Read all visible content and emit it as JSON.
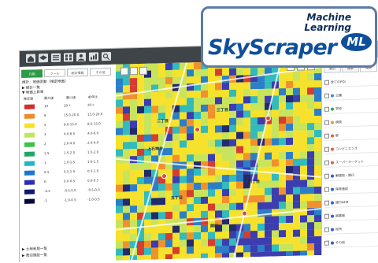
{
  "logo": {
    "line1": "Machine",
    "line2": "Learning",
    "brand": "SkyScraper",
    "badge": "ML"
  },
  "toolbar": {
    "icons": [
      "home-icon",
      "layer-icon",
      "list-icon",
      "grid-icon",
      "user-icon",
      "chart-icon",
      "search-icon"
    ]
  },
  "left_panel": {
    "tabs": [
      {
        "label": "凡例",
        "active": true
      },
      {
        "label": "ツール",
        "active": false
      },
      {
        "label": "統計情報",
        "active": false
      },
      {
        "label": "その他",
        "active": false
      }
    ],
    "header_text": "推計：地価変動（推定地価）",
    "section_open": "▶ 推計一覧",
    "section_legend": "▼ 地価上昇率",
    "legend_columns": [
      "推定値",
      "最大値",
      "最小値",
      "前年比"
    ],
    "legend": [
      {
        "color": "#d22f2f",
        "value": "10",
        "a": "20＋",
        "b": "20＋"
      },
      {
        "color": "#f08a2a",
        "value": "8",
        "a": "15.0-20.0",
        "b": "15.0-20.0"
      },
      {
        "color": "#f5e229",
        "value": "5",
        "a": "8.0-15.0",
        "b": "8.0-15.0"
      },
      {
        "color": "#c3e45e",
        "value": "3",
        "a": "4.0-8.0",
        "b": "4.0-8.0"
      },
      {
        "color": "#3fc14c",
        "value": "2",
        "a": "2.0-4.0",
        "b": "2.0-4.0"
      },
      {
        "color": "#1da867",
        "value": "1.5",
        "a": "1.5-2.0",
        "b": "1.5-2.0"
      },
      {
        "color": "#21b6c6",
        "value": "1",
        "a": "1.0-1.5",
        "b": "1.0-1.5"
      },
      {
        "color": "#1a76d1",
        "value": "0.5",
        "a": "0.5-1.0",
        "b": "0.5-1.0"
      },
      {
        "color": "#2a2fb8",
        "value": "0",
        "a": "0.0-0.5",
        "b": "0.0-0.5"
      },
      {
        "color": "#101a70",
        "value": "-0.5",
        "a": "-0.5-0.0",
        "b": "-0.5-0.0"
      },
      {
        "color": "#05063a",
        "value": "-1",
        "a": "-1.0-0.5",
        "b": "-1.0-0.5"
      }
    ],
    "footer_sections": [
      "▶ 土地利用一覧",
      "▶ 周辺施設一覧"
    ]
  },
  "map": {
    "labels": [
      "二丁目",
      "三丁目",
      "四丁目",
      "五丁目",
      "上石神井",
      "関町"
    ]
  },
  "right_panel": {
    "tabs": [
      {
        "label": "表示",
        "active": false
      },
      {
        "label": "検索",
        "active": false
      },
      {
        "label": "施設",
        "active": true
      }
    ],
    "items": [
      {
        "label": "全てのPOI",
        "color": ""
      },
      {
        "label": "公園",
        "color": "#3b8cd8"
      },
      {
        "label": "学校",
        "color": "#2aa35a"
      },
      {
        "label": "病院",
        "color": "#e0a12e"
      },
      {
        "label": "駅",
        "color": "#e45d3a"
      },
      {
        "label": "コンビニエンス",
        "color": "#e45d3a"
      },
      {
        "label": "スーパーマーケット",
        "color": "#e45d3a"
      },
      {
        "label": "郵便局・銀行",
        "color": "#2a5bd8"
      },
      {
        "label": "保育施設",
        "color": "#2a5bd8"
      },
      {
        "label": "銀行ATM",
        "color": "#2a5bd8"
      },
      {
        "label": "図書館",
        "color": "#2a5bd8"
      },
      {
        "label": "役所",
        "color": "#2a5bd8"
      },
      {
        "label": "その他",
        "color": "#2a5bd8"
      }
    ]
  },
  "colors": {
    "toolbar_bg": "#3f4449",
    "accent": "#2f9a45",
    "logo_blue": "#0f4f9a"
  }
}
